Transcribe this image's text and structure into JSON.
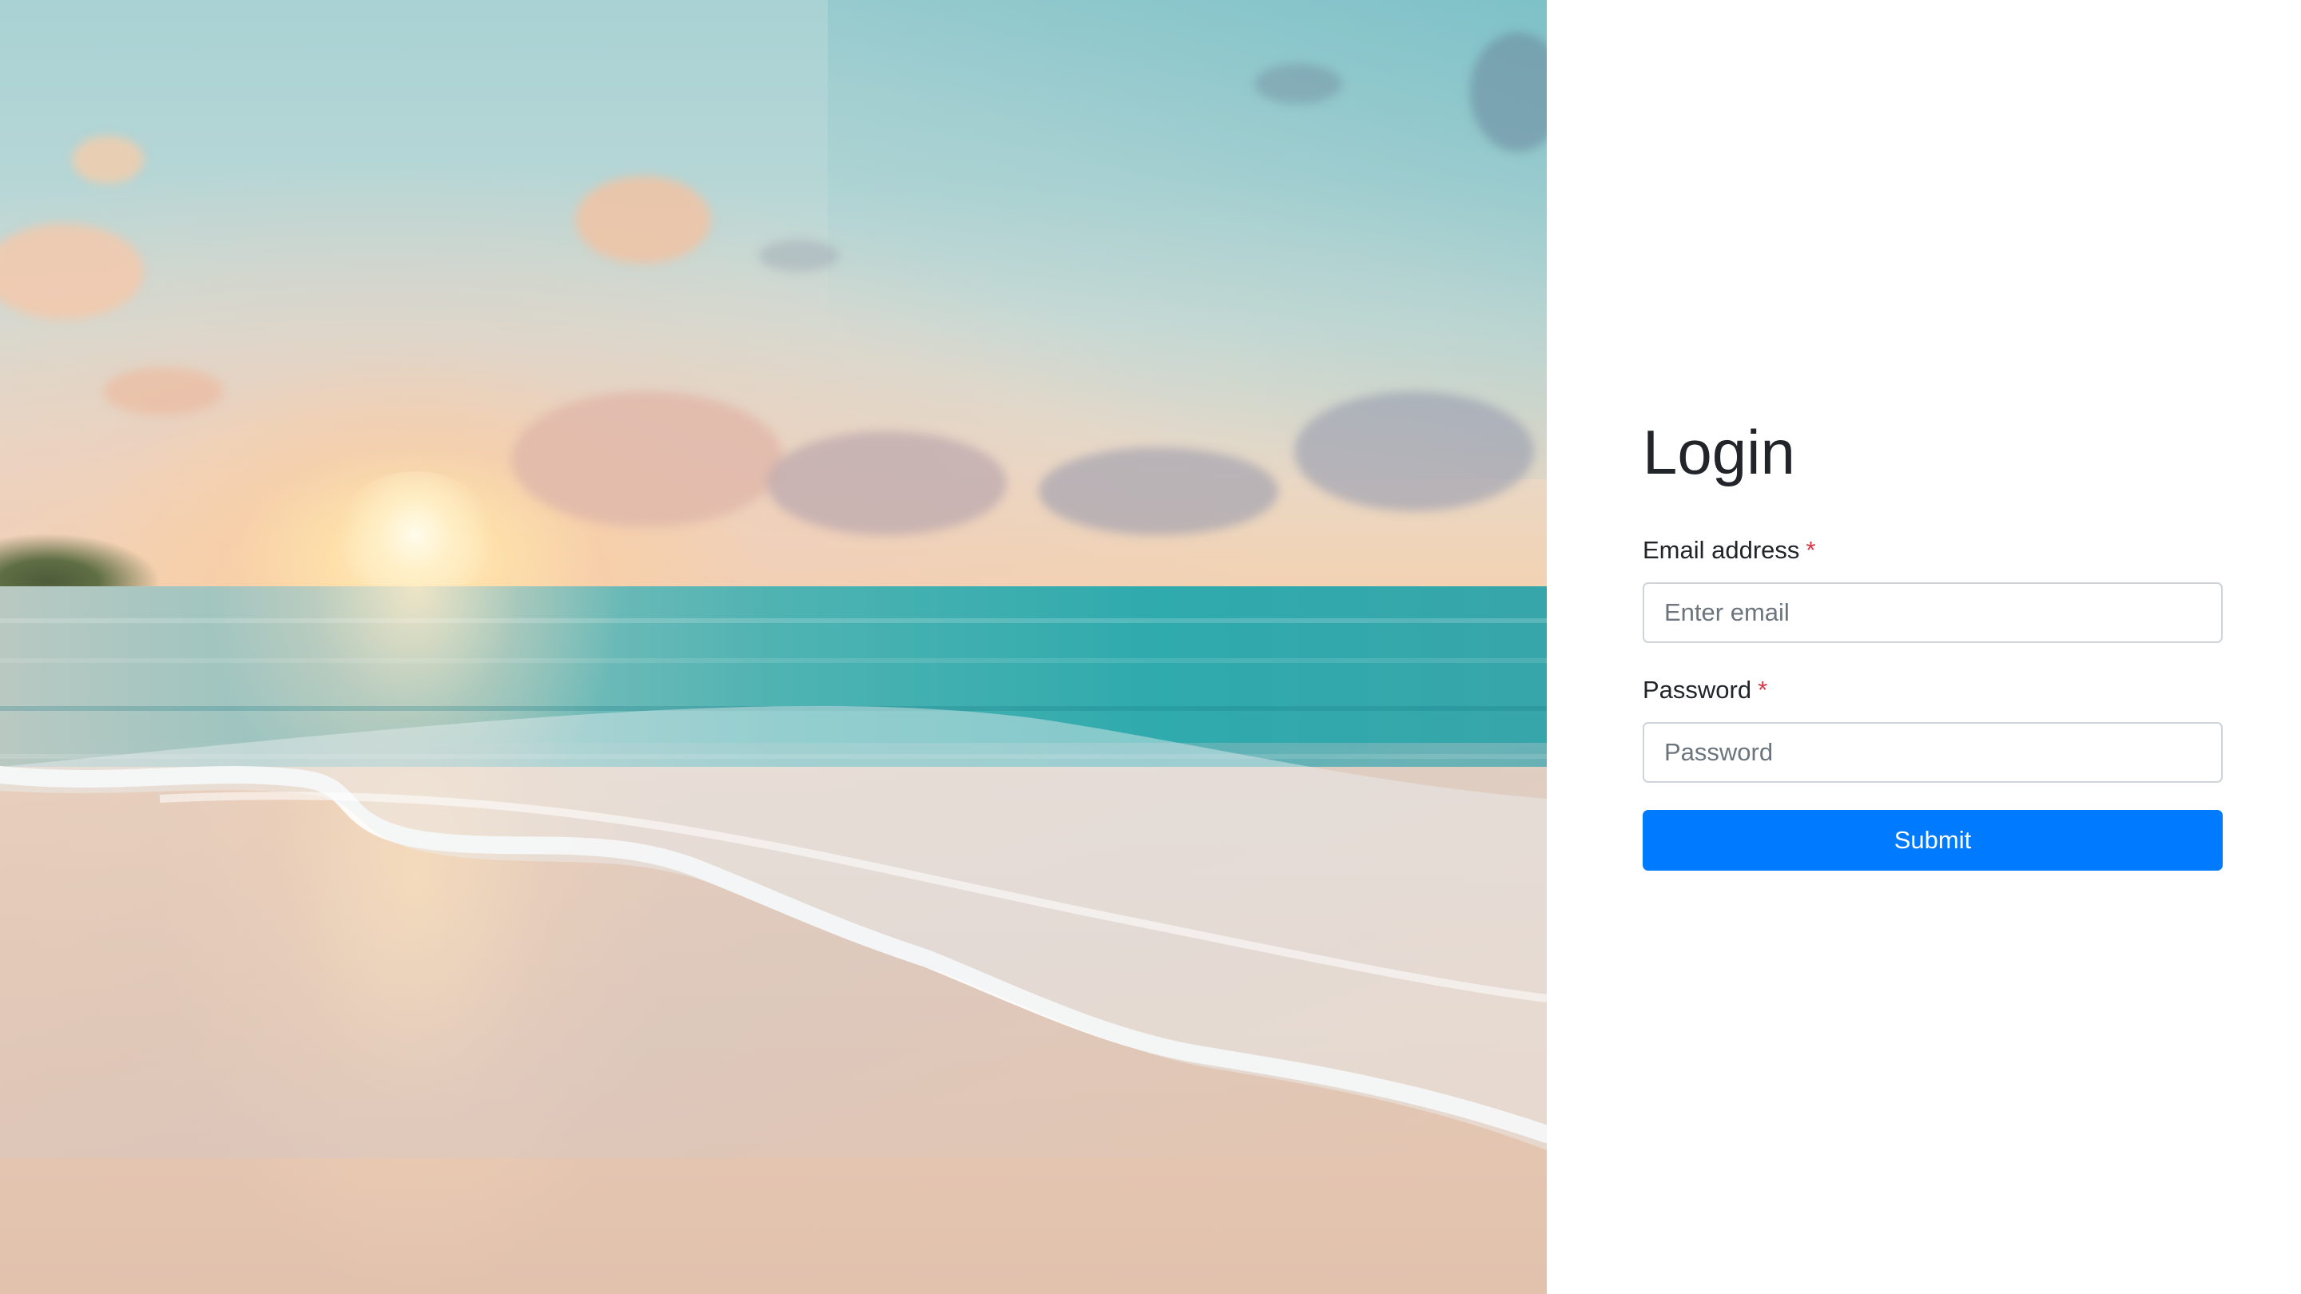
{
  "hero": {
    "image_description_icon": "beach-sunset-image"
  },
  "form": {
    "title": "Login",
    "email": {
      "label": "Email address",
      "required_mark": "*",
      "placeholder": "Enter email",
      "value": ""
    },
    "password": {
      "label": "Password",
      "required_mark": "*",
      "placeholder": "Password",
      "value": ""
    },
    "submit_label": "Submit"
  },
  "colors": {
    "accent": "#007bff",
    "required": "#dc3545",
    "text": "#212529",
    "input_border": "#ced4da"
  }
}
